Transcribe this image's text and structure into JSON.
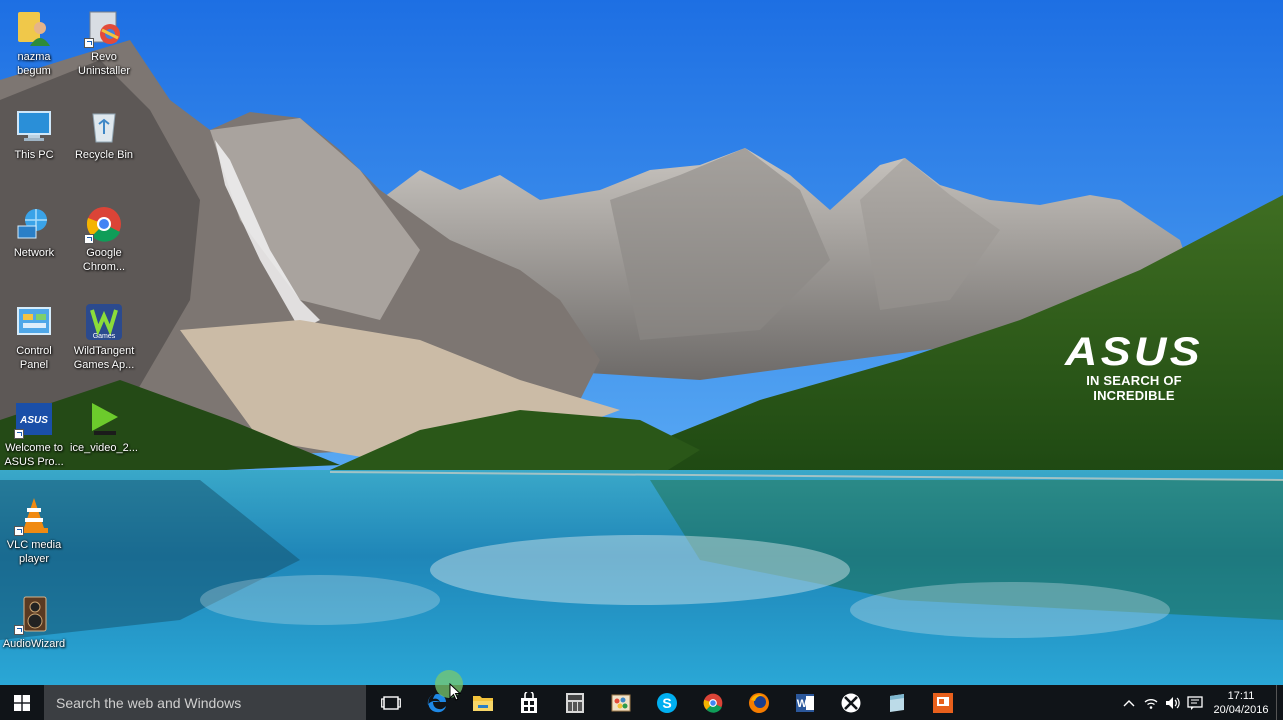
{
  "desktop": {
    "icons": [
      {
        "label": "nazma\nbegum",
        "icon": "user-folder-icon"
      },
      {
        "label": "Revo\nUninstaller",
        "icon": "revo-uninstaller-icon"
      },
      {
        "label": "This PC",
        "icon": "computer-icon"
      },
      {
        "label": "Recycle Bin",
        "icon": "recycle-bin-icon"
      },
      {
        "label": "Network",
        "icon": "network-icon"
      },
      {
        "label": "Google\nChrom...",
        "icon": "chrome-icon"
      },
      {
        "label": "Control\nPanel",
        "icon": "control-panel-icon"
      },
      {
        "label": "WildTangent\nGames Ap...",
        "icon": "wildtangent-icon",
        "badge": "Games"
      },
      {
        "label": "Welcome to\nASUS Pro...",
        "icon": "asus-icon",
        "badge": "ASUS"
      },
      {
        "label": "ice_video_2...",
        "icon": "video-file-icon"
      },
      {
        "label": "VLC media\nplayer",
        "icon": "vlc-icon"
      },
      {
        "label": "AudioWizard",
        "icon": "audiowizard-icon"
      }
    ],
    "wallpaper_logo": {
      "brand": "ASUS",
      "tagline": "IN SEARCH OF INCREDIBLE"
    }
  },
  "taskbar": {
    "search_placeholder": "Search the web and Windows",
    "pinned": [
      {
        "name": "edge-icon",
        "title": "Microsoft Edge"
      },
      {
        "name": "file-explorer-icon",
        "title": "File Explorer"
      },
      {
        "name": "store-icon",
        "title": "Store"
      },
      {
        "name": "calculator-icon",
        "title": "App"
      },
      {
        "name": "paint-icon",
        "title": "App"
      },
      {
        "name": "skype-icon",
        "title": "Skype"
      },
      {
        "name": "chrome-icon",
        "title": "Google Chrome"
      },
      {
        "name": "firefox-icon",
        "title": "Firefox"
      },
      {
        "name": "word-icon",
        "title": "Word"
      },
      {
        "name": "xbox-icon",
        "title": "Xbox"
      },
      {
        "name": "notes-icon",
        "title": "App"
      },
      {
        "name": "presentation-icon",
        "title": "App"
      }
    ],
    "tray": {
      "time": "17:11",
      "date": "20/04/2016"
    }
  },
  "colors": {
    "taskbar_bg": "#101418",
    "search_bg": "#3b3e42",
    "sky": "#1f78e6",
    "lake": "#2ba6cf"
  }
}
